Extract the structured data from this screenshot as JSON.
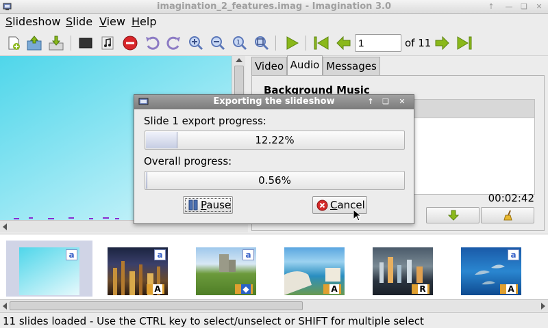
{
  "window": {
    "title": "imagination_2_features.imag - Imagination 3.0"
  },
  "menu": [
    {
      "mnemonic": "S",
      "rest": "lideshow"
    },
    {
      "mnemonic": "S",
      "rest": "lide"
    },
    {
      "mnemonic": "V",
      "rest": "iew"
    },
    {
      "mnemonic": "H",
      "rest": "elp"
    }
  ],
  "toolbar": {
    "icons": [
      "new-slideshow-icon",
      "open-slideshow-icon",
      "save-slideshow-icon",
      "add-empty-slide-icon",
      "import-music-icon",
      "delete-slide-icon",
      "rotate-left-icon",
      "rotate-right-icon",
      "zoom-in-icon",
      "zoom-out-icon",
      "zoom-normal-icon",
      "zoom-fit-icon",
      "play-icon",
      "first-slide-icon",
      "previous-slide-icon",
      "next-slide-icon",
      "last-slide-icon"
    ],
    "slide_number": "1",
    "of_label": "of 11"
  },
  "tabs": [
    "Video",
    "Audio",
    "Messages"
  ],
  "active_tab": "Audio",
  "audio_panel": {
    "title": "Background Music",
    "duration": "00:02:42"
  },
  "dialog": {
    "title": "Exporting the slideshow",
    "slide_label": "Slide 1 export progress:",
    "slide_progress": 0.1222,
    "slide_progress_text": "12.22%",
    "overall_label": "Overall progress:",
    "overall_progress": 0.0056,
    "overall_progress_text": "0.56%",
    "pause": {
      "mnemonic": "P",
      "rest": "ause"
    },
    "cancel": {
      "mnemonic": "C",
      "rest": "ancel"
    }
  },
  "thumbnails": [
    {
      "name": "slide-1",
      "selected": true
    },
    {
      "name": "slide-2-city-night"
    },
    {
      "name": "slide-3-castle"
    },
    {
      "name": "slide-4-coast"
    },
    {
      "name": "slide-5-hong-kong"
    },
    {
      "name": "slide-6-dolphins"
    }
  ],
  "status": "11 slides loaded  - Use the CTRL key to select/unselect or SHIFT for multiple select",
  "colors": {
    "accent_green": "#8ab81a",
    "progress_fill": "#c6cde3",
    "selection": "#d0d4e6"
  }
}
